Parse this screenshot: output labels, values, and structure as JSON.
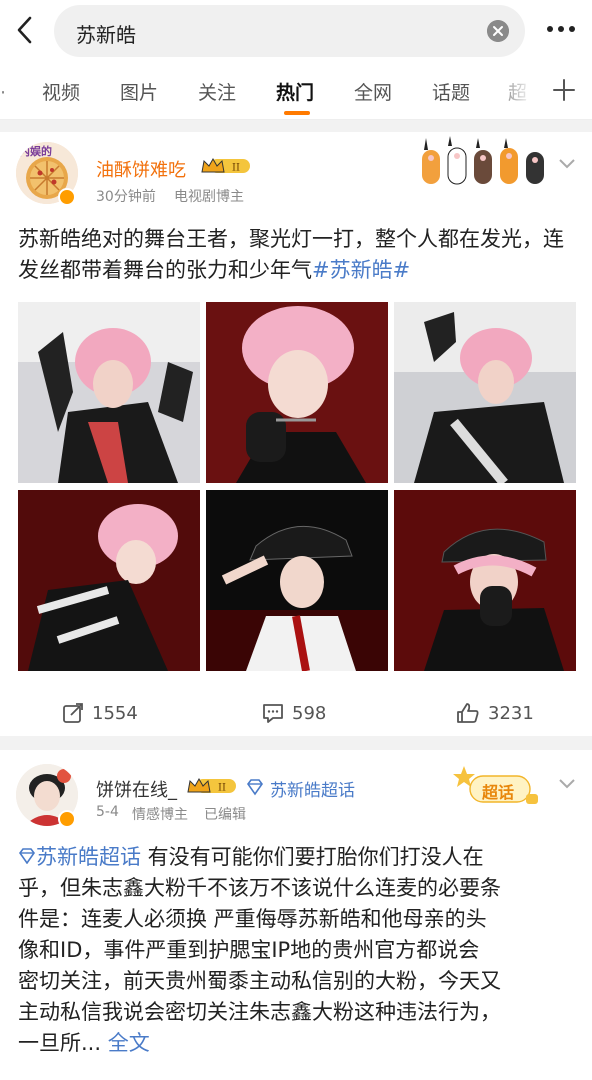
{
  "search": {
    "query": "苏新皓"
  },
  "tabs": {
    "edge": "·",
    "items": [
      "视频",
      "图片",
      "关注",
      "热门",
      "全网",
      "话题",
      "超"
    ],
    "active": "热门"
  },
  "post1": {
    "user": "油酥饼难吃",
    "level": "II",
    "time": "30分钟前",
    "role": "电视剧博主",
    "avatar_text": "内娱的",
    "text": "苏新皓绝对的舞台王者，聚光灯一打，整个人都在发光，连发丝都带着舞台的张力和少年气",
    "hashtag": "#苏新皓#",
    "reposts": "1554",
    "comments": "598",
    "likes": "3231"
  },
  "post2": {
    "user": "饼饼在线_",
    "level": "II",
    "supertopic": "苏新皓超话",
    "date": "5-4",
    "role": "情感博主",
    "edited": "已编辑",
    "badge": "超话",
    "topic_link": "苏新皓超话",
    "lines": [
      " 有没有可能你们要打胎你们打没人在",
      "乎，但朱志鑫大粉千不该万不该说什么连麦的必要条",
      "件是：连麦人必须换 严重侮辱苏新皓和他母亲的头",
      "像和ID，事件严重到护腮宝IP地的贵州官方都说会",
      "密切关注，前天贵州蜀黍主动私信别的大粉，今天又",
      "主动私信我说会密切关注朱志鑫大粉这种违法行为，",
      "一旦所..."
    ],
    "more": " 全文"
  },
  "colors": {
    "accent": "#ff7a00",
    "link": "#4a7bc8",
    "username": "#f2710c"
  }
}
